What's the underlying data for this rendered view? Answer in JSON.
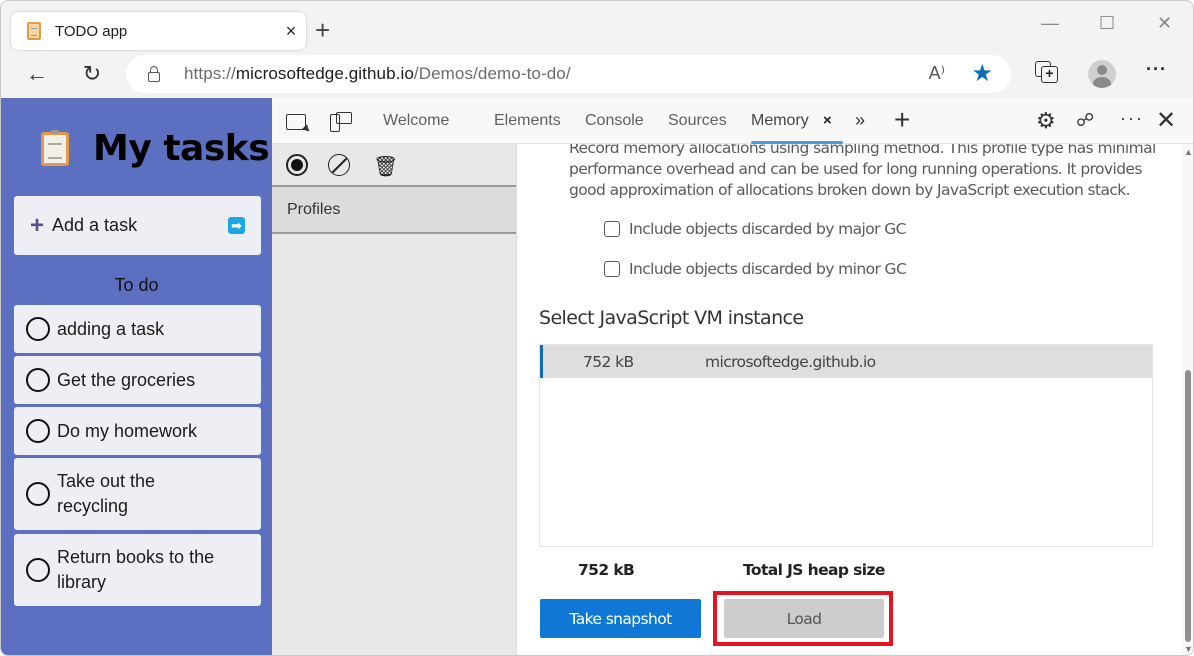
{
  "browser": {
    "tab": {
      "title": "TODO app",
      "close": "×"
    },
    "new_tab": "+",
    "window_controls": {
      "minimize": "—",
      "maximize": "☐",
      "close": "✕"
    },
    "nav": {
      "back": "←",
      "refresh": "↻"
    },
    "url": {
      "scheme": "https://",
      "host": "microsoftedge.github.io",
      "path": "/Demos/demo-to-do/"
    },
    "read_aloud": "A⁾",
    "favorite": "★",
    "more": "···"
  },
  "app": {
    "title": "My tasks",
    "add_task": {
      "label": "Add a task",
      "plus": "+",
      "submit": "➡"
    },
    "section_heading": "To do",
    "tasks": [
      {
        "label": "adding a task",
        "done": false
      },
      {
        "label": "Get the groceries",
        "done": false
      },
      {
        "label": "Do my homework",
        "done": false
      },
      {
        "label": "Take out the recycling",
        "done": false
      },
      {
        "label": "Return books to the library",
        "done": false
      }
    ]
  },
  "devtools": {
    "tabs": [
      {
        "label": "Welcome",
        "active": false
      },
      {
        "label": "Elements",
        "active": false
      },
      {
        "label": "Console",
        "active": false
      },
      {
        "label": "Sources",
        "active": false
      },
      {
        "label": "Memory",
        "active": true
      }
    ],
    "memory_close": "×",
    "overflow": "»",
    "add_tool": "+",
    "settings": "⚙",
    "feedback": "☍",
    "more": "···",
    "close": "✕",
    "sidebar": {
      "trash": "🗑",
      "profiles_label": "Profiles"
    },
    "memory": {
      "description": "Record memory allocations using sampling method. This profile type has minimal performance overhead and can be used for long running operations. It provides good approximation of allocations broken down by JavaScript execution stack.",
      "options": [
        {
          "label": "Include objects discarded by major GC",
          "checked": false
        },
        {
          "label": "Include objects discarded by minor GC",
          "checked": false
        }
      ],
      "vm_title": "Select JavaScript VM instance",
      "vm_instances": [
        {
          "size": "752 kB",
          "name": "microsoftedge.github.io",
          "selected": true
        }
      ],
      "total_heap_size": "752 kB",
      "total_heap_label": "Total JS heap size",
      "take_snapshot_label": "Take snapshot",
      "load_label": "Load"
    },
    "scrollbar": {
      "up": "▲",
      "down": "▼"
    }
  },
  "colors": {
    "app_background": "#5d6fc1",
    "accent_blue": "#0f78d4",
    "highlight_red": "#e3141f",
    "active_tab_underline": "#4a9de3"
  }
}
